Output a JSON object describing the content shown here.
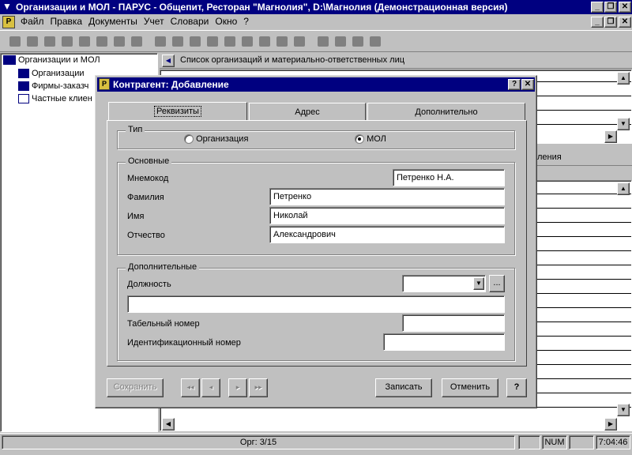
{
  "app": {
    "title": "Организации и МОЛ - ПАРУС - Общепит, Ресторан \"Магнолия\", D:\\Магнолия (Демонстрационная версия)",
    "window_buttons": [
      "_",
      "❐",
      "✕"
    ]
  },
  "menu": {
    "items": [
      "Файл",
      "Правка",
      "Документы",
      "Учет",
      "Словари",
      "Окно",
      "?"
    ],
    "mdi_buttons": [
      "_",
      "❐",
      "✕"
    ]
  },
  "tree": {
    "root": "Организации и МОЛ",
    "children": [
      "Организации",
      "Фирмы-заказч",
      "Частные клиен"
    ]
  },
  "list_panel": {
    "title": "Список организаций и материально-ответственных лиц",
    "partial_header_2": "ления"
  },
  "dialog": {
    "title": "Контрагент: Добавление",
    "help_btn": "?",
    "close_btn": "✕",
    "tabs": [
      "Реквизиты",
      "Адрес",
      "Дополнительно"
    ],
    "type_group": {
      "legend": "Тип",
      "options": [
        "Организация",
        "МОЛ"
      ],
      "selected": "МОЛ"
    },
    "main_group": {
      "legend": "Основные",
      "mnemocode_label": "Мнемокод",
      "mnemocode_value": "Петренко Н.А.",
      "surname_label": "Фамилия",
      "surname_value": "Петренко",
      "name_label": "Имя",
      "name_value": "Николай",
      "patronymic_label": "Отчество",
      "patronymic_value": "Александрович"
    },
    "extra_group": {
      "legend": "Дополнительные",
      "position_label": "Должность",
      "position_value": "",
      "position_text": "",
      "ellipsis": "...",
      "tabnum_label": "Табельный номер",
      "tabnum_value": "",
      "idnum_label": "Идентификационный номер",
      "idnum_value": ""
    },
    "buttons": {
      "save": "Сохранить",
      "first": "◂◂",
      "prev": "◂",
      "next": "▸",
      "last": "▸▸",
      "record": "Записать",
      "cancel": "Отменить",
      "help": "?"
    }
  },
  "status": {
    "record_counter": "Орг: 3/15",
    "num": "NUM",
    "time": "7:04:46"
  }
}
